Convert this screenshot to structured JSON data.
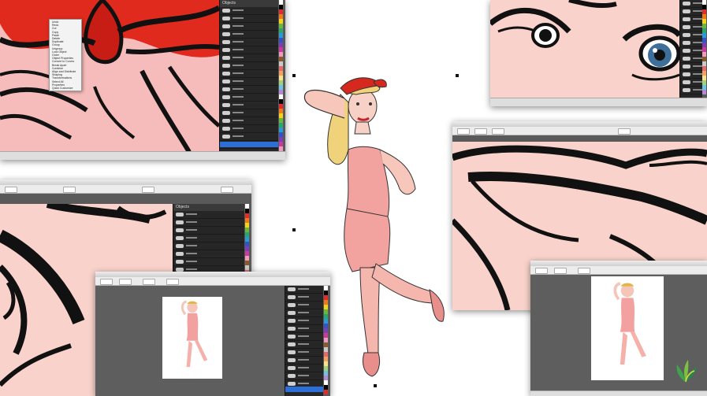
{
  "windows": {
    "bow": {
      "title": "",
      "context_menu": [
        "Undo",
        "Redo",
        "Cut",
        "Copy",
        "Paste",
        "Delete",
        "Duplicate",
        "Group",
        "Ungroup",
        "Lock Object",
        "Order",
        "Object Properties",
        "Convert to Curves",
        "Break Apart",
        "Combine",
        "Align and Distribute",
        "Shaping",
        "Transformations",
        "Select All",
        "Properties",
        "Quick Customize"
      ],
      "docker_title": "Objects",
      "status": ""
    },
    "eyes": {
      "title": "",
      "status": ""
    },
    "lips": {
      "title": "",
      "status": ""
    },
    "eye_left": {
      "docker_title": "Objects",
      "status": ""
    },
    "center_doc": {
      "status": ""
    },
    "right_doc": {
      "status": ""
    }
  },
  "palette_colors": [
    "#ffffff",
    "#000000",
    "#e22b2b",
    "#f07a1a",
    "#f7d21b",
    "#6ab83b",
    "#2aa66e",
    "#2a9ad6",
    "#3355c4",
    "#7a3fb4",
    "#c73b9a",
    "#f19ac0",
    "#8b5a2b",
    "#c9c9c9",
    "#e76a6a",
    "#f4a261",
    "#ffe08a",
    "#9fd27a",
    "#6fc3df",
    "#b28ad6"
  ],
  "app_logo": "coreldraw-logo-icon"
}
